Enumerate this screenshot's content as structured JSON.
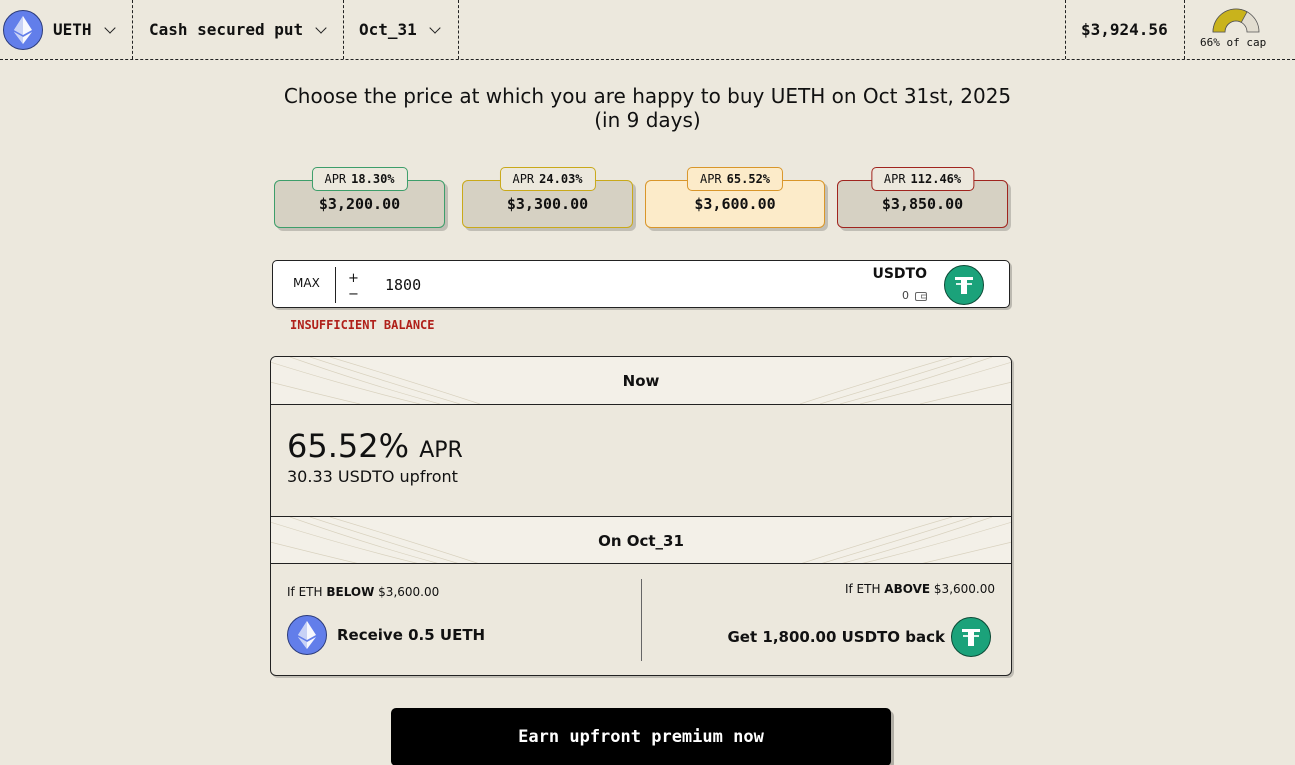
{
  "topbar": {
    "asset": "UETH",
    "strategy": "Cash secured put",
    "expiry": "Oct_31",
    "price": "$3,924.56",
    "cap_label": "66% of cap",
    "cap_fraction": 0.66
  },
  "headline": {
    "line1": "Choose the price at which you are happy to buy UETH on Oct 31st, 2025",
    "line2": "(in 9 days)"
  },
  "strikes": [
    {
      "apr_label": "APR",
      "apr": "18.30%",
      "price": "$3,200.00",
      "color": "#3D9E6A",
      "selected": false
    },
    {
      "apr_label": "APR",
      "apr": "24.03%",
      "price": "$3,300.00",
      "color": "#C9A91A",
      "selected": false
    },
    {
      "apr_label": "APR",
      "apr": "65.52%",
      "price": "$3,600.00",
      "color": "#D9962A",
      "selected": true
    },
    {
      "apr_label": "APR",
      "apr": "112.46%",
      "price": "$3,850.00",
      "color": "#A0241E",
      "selected": false
    }
  ],
  "amount": {
    "max_label": "MAX",
    "plus": "+",
    "minus": "−",
    "value": "1800",
    "token": "USDTO",
    "balance": "0"
  },
  "error": "INSUFFICIENT BALANCE",
  "summary": {
    "now_header": "Now",
    "apr_value": "65.52%",
    "apr_unit": "APR",
    "upfront": "30.33 USDTO upfront",
    "on_header": "On Oct_31",
    "below": {
      "prefix": "If ETH",
      "word": "BELOW",
      "price": "$3,600.00",
      "result": "Receive 0.5 UETH"
    },
    "above": {
      "prefix": "If ETH",
      "word": "ABOVE",
      "price": "$3,600.00",
      "result": "Get 1,800.00 USDTO back"
    }
  },
  "cta": "Earn upfront premium now",
  "colors": {
    "background": "#ECE8DD",
    "eth": "#627EEA",
    "usdt": "#1BA27A",
    "error": "#B0201A",
    "gauge": "#C9B31C"
  }
}
